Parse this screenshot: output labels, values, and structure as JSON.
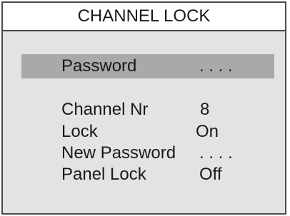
{
  "menu": {
    "title": "CHANNEL LOCK",
    "selected_index": 0,
    "items": [
      {
        "label": "Password",
        "value": ". . . ."
      },
      {
        "label": "Channel Nr",
        "value": "8"
      },
      {
        "label": "Lock",
        "value": "On"
      },
      {
        "label": "New Password",
        "value": ". . . ."
      },
      {
        "label": "Panel Lock",
        "value": "Off"
      }
    ]
  },
  "colors": {
    "panel_background": "#e3e3e3",
    "selection_highlight": "#a9a9a9",
    "border": "#4a4a4a",
    "text": "#1a1a1a"
  }
}
